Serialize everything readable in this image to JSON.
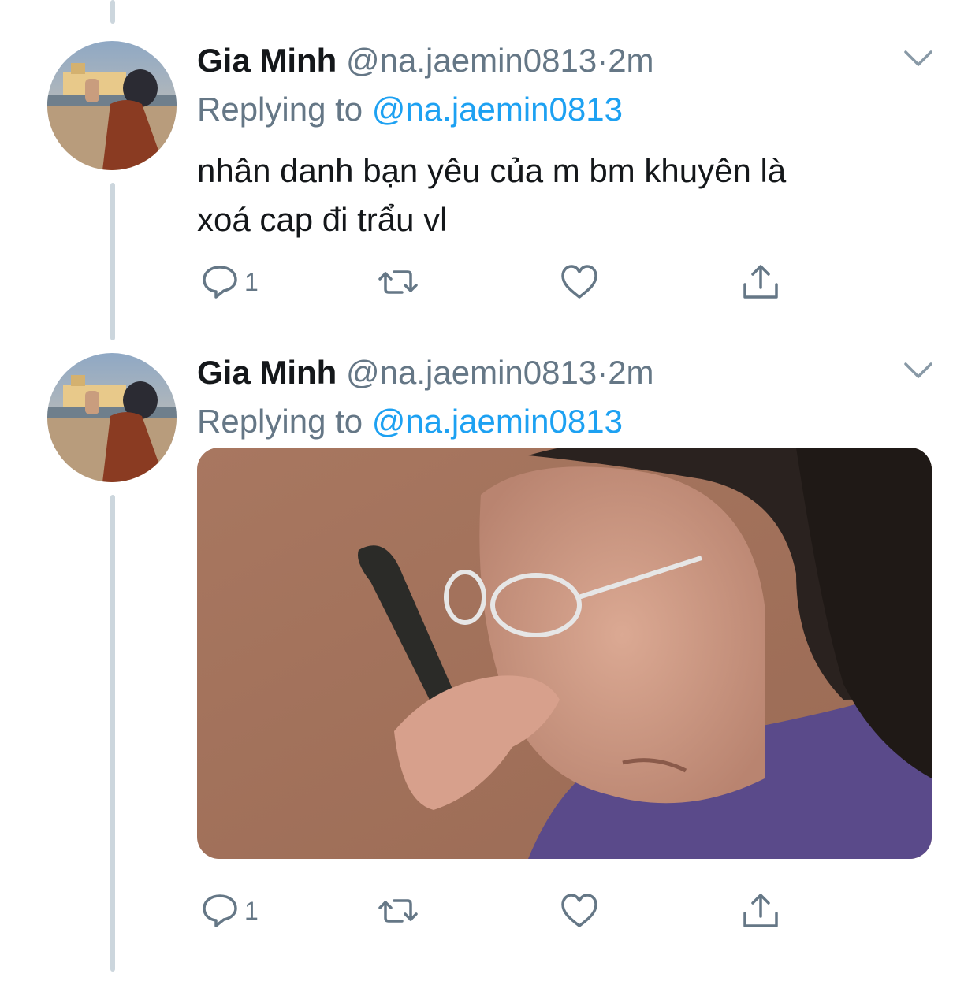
{
  "tweets": [
    {
      "author": {
        "name": "Gia Minh",
        "handle": "@na.jaemin0813"
      },
      "separator": "·",
      "time": "2m",
      "replying_prefix": "Replying to",
      "replying_to": "@na.jaemin0813",
      "text_lines": [
        "nhân danh bạn yêu của m bm khuyên là",
        "xoá cap đi trẩu vl"
      ],
      "actions": {
        "reply_count": "1",
        "retweet_count": "",
        "like_count": ""
      }
    },
    {
      "author": {
        "name": "Gia Minh",
        "handle": "@na.jaemin0813"
      },
      "separator": "·",
      "time": "2m",
      "replying_prefix": "Replying to",
      "replying_to": "@na.jaemin0813",
      "media": {
        "type": "photo"
      },
      "actions": {
        "reply_count": "1",
        "retweet_count": "",
        "like_count": ""
      }
    }
  ],
  "icons": {
    "reply": "reply-icon",
    "retweet": "retweet-icon",
    "like": "heart-icon",
    "share": "share-icon",
    "menu": "chevron-down-icon"
  },
  "colors": {
    "text": "#14171a",
    "secondary": "#657786",
    "link": "#1da1f2",
    "thread_line": "#ccd6dd"
  }
}
